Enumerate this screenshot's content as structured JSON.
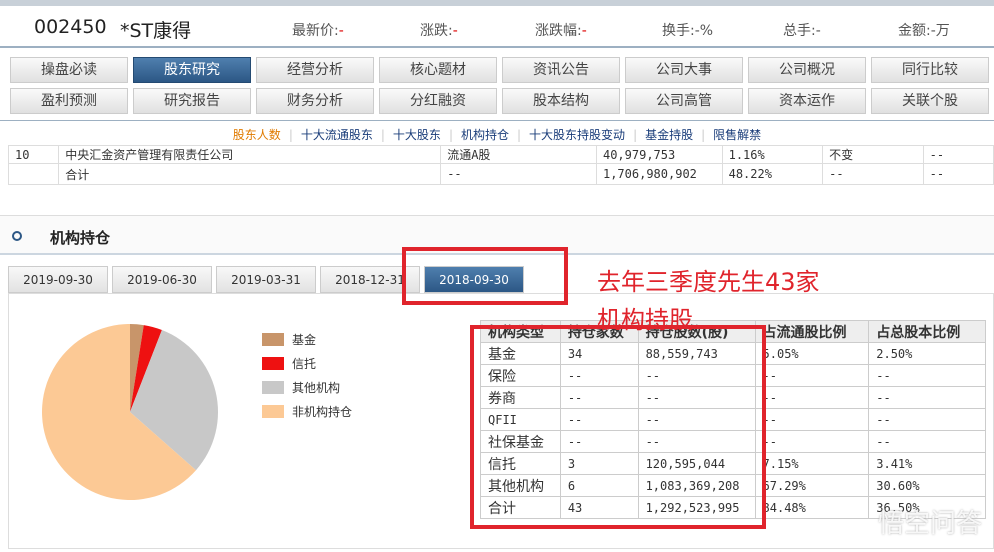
{
  "header": {
    "code": "002450",
    "name": "*ST康得",
    "quotes": [
      {
        "label": "最新价:",
        "value": "-"
      },
      {
        "label": "涨跌:",
        "value": "-"
      },
      {
        "label": "涨跌幅:",
        "value": "-"
      },
      {
        "label": "换手:",
        "value": "-%"
      },
      {
        "label": "总手:",
        "value": "-"
      },
      {
        "label": "金额:",
        "value": "-万"
      }
    ]
  },
  "tabs_row1": [
    "操盘必读",
    "股东研究",
    "经营分析",
    "核心题材",
    "资讯公告",
    "公司大事",
    "公司概况",
    "同行比较"
  ],
  "tabs_row2": [
    "盈利预测",
    "研究报告",
    "财务分析",
    "分红融资",
    "股本结构",
    "公司高管",
    "资本运作",
    "关联个股"
  ],
  "subnav": [
    "股东人数",
    "十大流通股东",
    "十大股东",
    "机构持仓",
    "十大股东持股变动",
    "基金持股",
    "限售解禁"
  ],
  "top_table": [
    [
      "10",
      "中央汇金资产管理有限责任公司",
      "流通A股",
      "40,979,753",
      "1.16%",
      "不变",
      "--"
    ],
    [
      "",
      "合计",
      "--",
      "1,706,980,902",
      "48.22%",
      "--",
      "--"
    ]
  ],
  "section_title": "机构持仓",
  "date_tabs": [
    "2019-09-30",
    "2019-06-30",
    "2019-03-31",
    "2018-12-31",
    "2018-09-30"
  ],
  "legend": [
    {
      "label": "基金",
      "color": "#c8956a"
    },
    {
      "label": "信托",
      "color": "#ee1111"
    },
    {
      "label": "其他机构",
      "color": "#c8c8c8"
    },
    {
      "label": "非机构持仓",
      "color": "#fcc995"
    }
  ],
  "pie": {
    "values": [
      2.5,
      3.41,
      30.6,
      63.49
    ]
  },
  "inst_table": {
    "headers": [
      "机构类型",
      "持仓家数",
      "持仓股数(股)",
      "占流通股比例",
      "占总股本比例"
    ],
    "rows": [
      [
        "基金",
        "34",
        "88,559,743",
        "5.05%",
        "2.50%"
      ],
      [
        "保险",
        "--",
        "--",
        "--",
        "--"
      ],
      [
        "券商",
        "--",
        "--",
        "--",
        "--"
      ],
      [
        "QFII",
        "--",
        "--",
        "--",
        "--"
      ],
      [
        "社保基金",
        "--",
        "--",
        "--",
        "--"
      ],
      [
        "信托",
        "3",
        "120,595,044",
        "7.15%",
        "3.41%"
      ],
      [
        "其他机构",
        "6",
        "1,083,369,208",
        "67.29%",
        "30.60%"
      ],
      [
        "合计",
        "43",
        "1,292,523,995",
        "84.48%",
        "36.50%"
      ]
    ]
  },
  "annotation": {
    "line1": "去年三季度先生43家",
    "line2": "机构持股"
  },
  "watermark": "悟空问答"
}
